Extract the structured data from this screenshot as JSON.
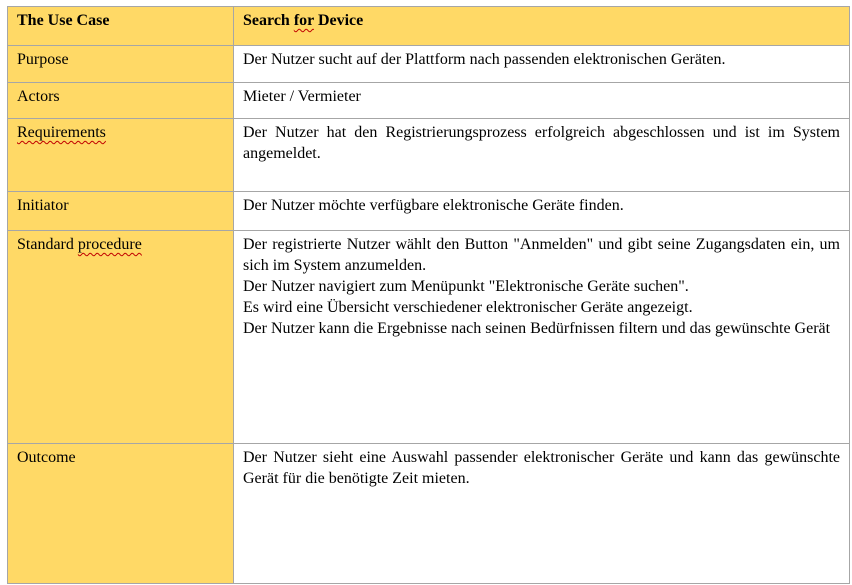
{
  "header": {
    "label_pre": "The Use Case",
    "value_pre": "Search ",
    "value_flag": "for",
    "value_post": " Device"
  },
  "rows": [
    {
      "label_pre": "Purpose",
      "label_flag": "",
      "value_lines": [
        "Der Nutzer sucht auf der Plattform nach passenden elektronischen Geräten."
      ]
    },
    {
      "label_pre": "Actors",
      "label_flag": "",
      "value_lines": [
        "Mieter / Vermieter"
      ]
    },
    {
      "label_pre": "",
      "label_flag": "Requirements",
      "value_lines": [
        "Der Nutzer hat den Registrierungsprozess erfolgreich abgeschlossen und ist im System angemeldet."
      ]
    },
    {
      "label_pre": "Initiator",
      "label_flag": "",
      "value_lines": [
        "Der Nutzer möchte verfügbare elektronische Geräte finden."
      ]
    },
    {
      "label_pre": "Standard ",
      "label_flag": "procedure",
      "value_lines": [
        "Der registrierte Nutzer wählt den Button \"Anmelden\" und gibt seine Zugangsdaten ein, um sich im System anzumelden.",
        "Der Nutzer navigiert zum Menüpunkt \"Elektronische Geräte suchen\".",
        "Es wird eine Übersicht verschiedener elektronischer Geräte angezeigt.",
        "Der Nutzer kann die Ergebnisse nach seinen Bedürfnissen filtern und das gewünschte Gerät"
      ]
    },
    {
      "label_pre": "Outcome",
      "label_flag": "",
      "value_lines": [
        "Der Nutzer sieht eine Auswahl passender elektronischer Geräte und kann das gewünschte Gerät für die benötigte Zeit mieten."
      ]
    }
  ]
}
